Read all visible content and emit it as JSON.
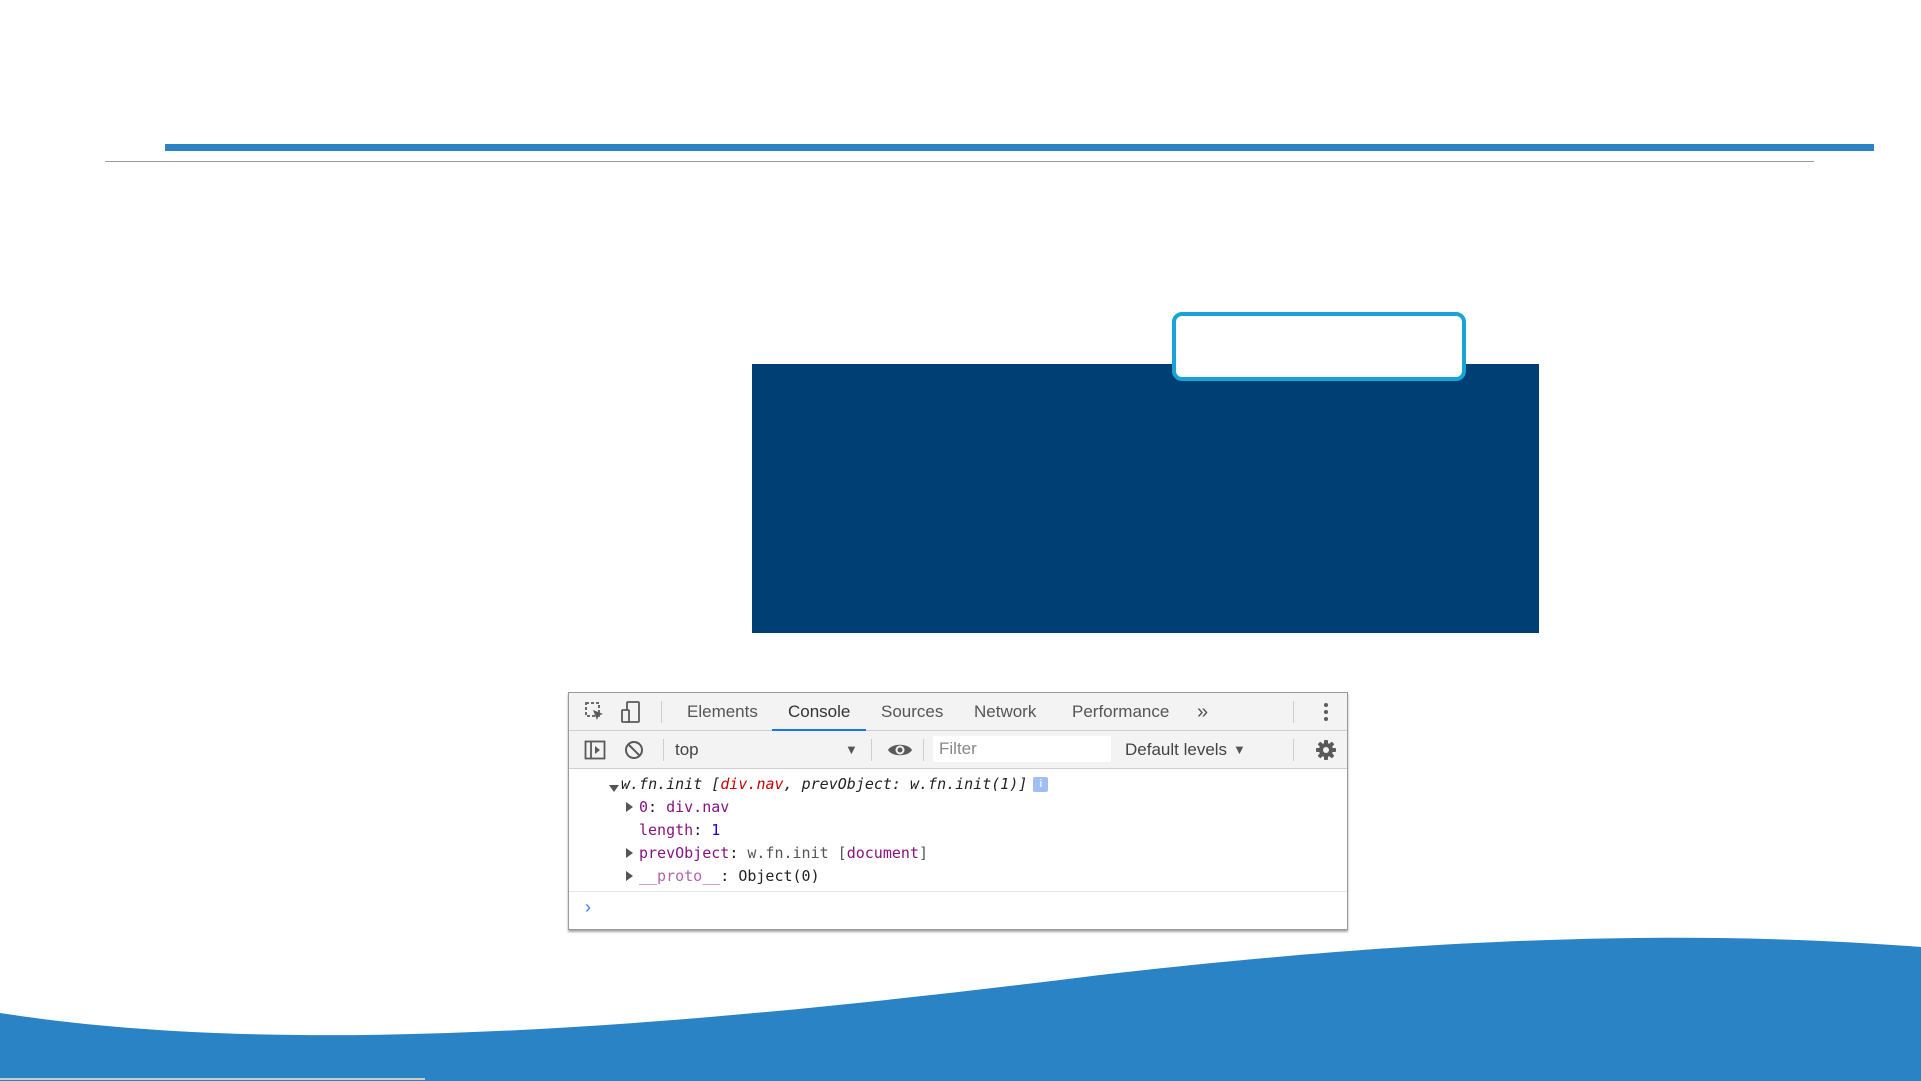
{
  "devtools": {
    "tabs": [
      "Elements",
      "Console",
      "Sources",
      "Network",
      "Performance"
    ],
    "active_tab": "Console",
    "more_tabs_label": "»",
    "context": "top",
    "filter_placeholder": "Filter",
    "levels_label": "Default levels",
    "console": {
      "line1": {
        "label": "w.fn.init [",
        "el": "div.nav",
        "mid": ", prevObject: w.fn.init(1)]",
        "badge": "i"
      },
      "line2": {
        "key": "0",
        "sep": ": ",
        "value": "div.nav"
      },
      "line3": {
        "key": "length",
        "sep": ": ",
        "value": "1"
      },
      "line4": {
        "key": "prevObject",
        "sep": ": ",
        "value_pre": "w.fn.init [",
        "value_el": "document",
        "value_post": "]"
      },
      "line5": {
        "key": "__proto__",
        "sep": ": ",
        "value": "Object(0)"
      },
      "prompt": "›"
    }
  },
  "colors": {
    "accent_blue": "#2a83c5",
    "dark_panel": "#003f74",
    "highlight_border": "#18a3d9",
    "tab_underline": "#1a73e8"
  },
  "icons": [
    "inspect-element-icon",
    "device-toolbar-icon",
    "sidebar-toggle-icon",
    "clear-console-icon",
    "eye-icon",
    "gear-icon",
    "kebab-menu-icon"
  ]
}
